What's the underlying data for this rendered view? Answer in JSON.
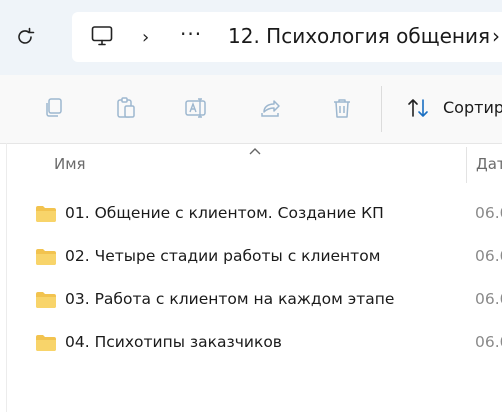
{
  "address_bar": {
    "more_label": "···",
    "breadcrumb": "12. Психология общения"
  },
  "toolbar": {
    "sort_label": "Сортир"
  },
  "columns": {
    "name": "Имя",
    "date": "Дат"
  },
  "files": [
    {
      "name": "01. Общение с клиентом. Создание КП",
      "date": "06.0"
    },
    {
      "name": "02. Четыре стадии работы с клиентом",
      "date": "06.0"
    },
    {
      "name": "03. Работа с клиентом на каждом этапе",
      "date": "06.0"
    },
    {
      "name": "04. Психотипы заказчиков",
      "date": "06.0"
    }
  ],
  "colors": {
    "address_band": "#eff4f9",
    "folder": "#f2c34f",
    "disabled_icon": "#9db7cf"
  }
}
